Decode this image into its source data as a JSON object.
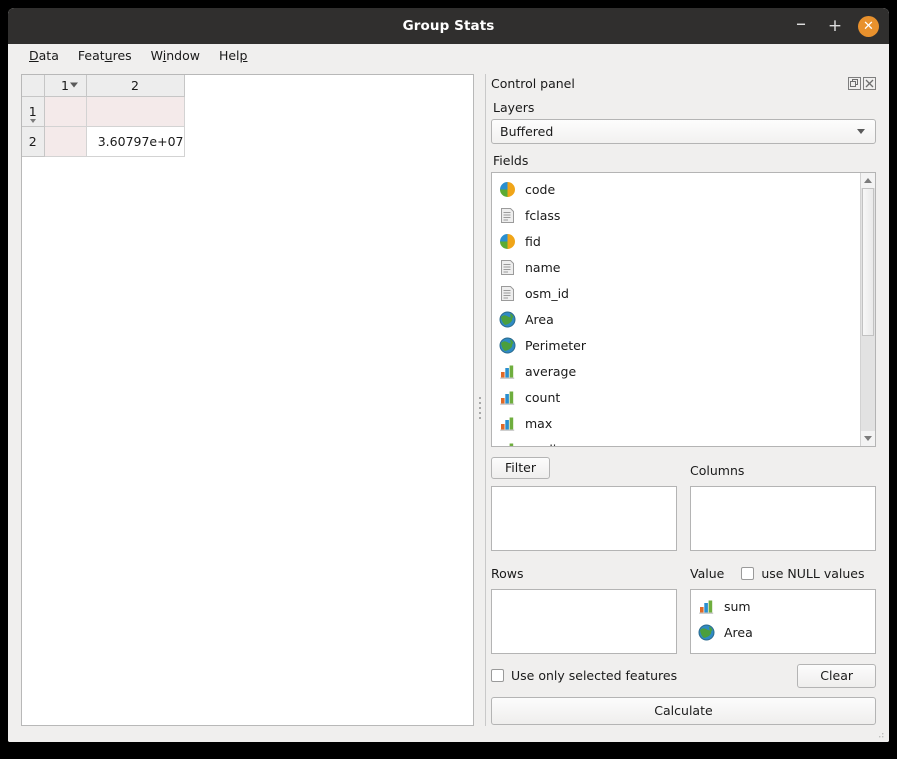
{
  "window": {
    "title": "Group Stats",
    "buttons": {
      "minimize": "–",
      "maximize": "+",
      "close": "✕"
    }
  },
  "menubar": {
    "items": [
      {
        "label": "Data",
        "mnemonic": "D"
      },
      {
        "label": "Features",
        "mnemonic": "u"
      },
      {
        "label": "Window",
        "mnemonic": "i"
      },
      {
        "label": "Help",
        "mnemonic": "p"
      }
    ]
  },
  "results_table": {
    "columns": [
      {
        "label": "1",
        "sortable": true
      },
      {
        "label": "2",
        "sortable": false
      }
    ],
    "rows": [
      {
        "header": "1",
        "expandable": true,
        "cells": [
          "",
          ""
        ],
        "selected": true
      },
      {
        "header": "2",
        "expandable": false,
        "cells": [
          "",
          "3.60797e+07"
        ],
        "selected": true
      }
    ]
  },
  "control_panel": {
    "title": "Control panel",
    "dock_icons": {
      "float": "float-icon",
      "close": "close-icon"
    },
    "layers": {
      "label": "Layers",
      "selected": "Buffered",
      "options": [
        "Buffered"
      ]
    },
    "fields": {
      "label": "Fields",
      "items": [
        {
          "label": "code",
          "icon": "numeric-field-icon"
        },
        {
          "label": "fclass",
          "icon": "text-field-icon"
        },
        {
          "label": "fid",
          "icon": "numeric-field-icon"
        },
        {
          "label": "name",
          "icon": "text-field-icon"
        },
        {
          "label": "osm_id",
          "icon": "text-field-icon"
        },
        {
          "label": "Area",
          "icon": "geometry-field-icon"
        },
        {
          "label": "Perimeter",
          "icon": "geometry-field-icon"
        },
        {
          "label": "average",
          "icon": "statistic-icon"
        },
        {
          "label": "count",
          "icon": "statistic-icon"
        },
        {
          "label": "max",
          "icon": "statistic-icon"
        },
        {
          "label": "median",
          "icon": "statistic-icon"
        }
      ],
      "scroll_thumb_percent": 61
    },
    "filter": {
      "button_label": "Filter",
      "items": []
    },
    "columns": {
      "label": "Columns",
      "items": []
    },
    "rows": {
      "label": "Rows",
      "items": []
    },
    "value": {
      "label": "Value",
      "use_null_values": {
        "label": "use NULL values",
        "checked": false
      },
      "items": [
        {
          "label": "sum",
          "icon": "statistic-icon"
        },
        {
          "label": "Area",
          "icon": "geometry-field-icon"
        }
      ]
    },
    "use_only_selected": {
      "label": "Use only selected features",
      "checked": false
    },
    "clear_button": "Clear",
    "calculate_button": "Calculate"
  },
  "colors": {
    "titlebar": "#302f2e",
    "close_button": "#e8912d",
    "panel_background": "#f0efee",
    "selection_tint": "#f4eaea"
  }
}
